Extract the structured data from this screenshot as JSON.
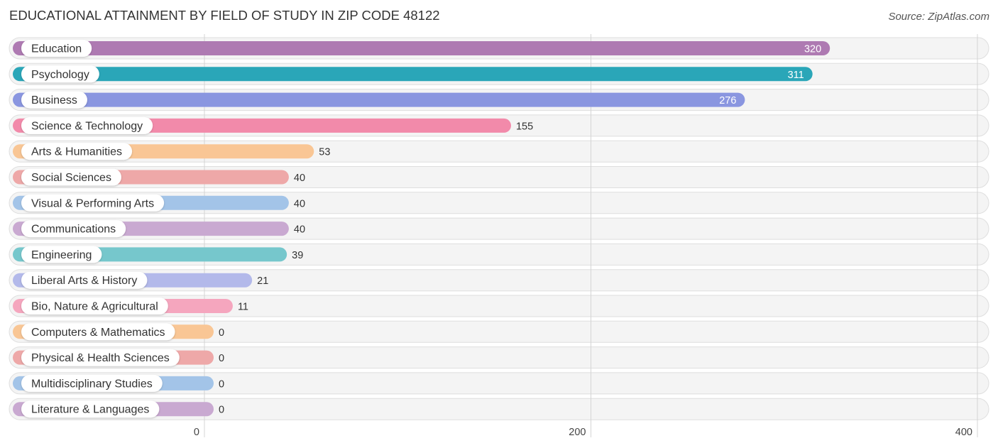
{
  "chart_data": {
    "type": "bar",
    "orientation": "horizontal",
    "title": "EDUCATIONAL ATTAINMENT BY FIELD OF STUDY IN ZIP CODE 48122",
    "source": "Source: ZipAtlas.com",
    "xlabel": "",
    "ylabel": "",
    "xlim": [
      0,
      400
    ],
    "ticks": [
      0,
      200,
      400
    ],
    "tick_labels": [
      "0",
      "200",
      "400"
    ],
    "grid": true,
    "categories": [
      "Education",
      "Psychology",
      "Business",
      "Science & Technology",
      "Arts & Humanities",
      "Social Sciences",
      "Visual & Performing Arts",
      "Communications",
      "Engineering",
      "Liberal Arts & History",
      "Bio, Nature & Agricultural",
      "Computers & Mathematics",
      "Physical & Health Sciences",
      "Multidisciplinary Studies",
      "Literature & Languages"
    ],
    "values": [
      320,
      311,
      276,
      155,
      53,
      40,
      40,
      40,
      39,
      21,
      11,
      0,
      0,
      0,
      0
    ],
    "colors": [
      "#ae7ab2",
      "#2aa6b8",
      "#8a96e0",
      "#f28aaa",
      "#f9c695",
      "#eea8a8",
      "#a3c4e8",
      "#c9a9d1",
      "#76c7cc",
      "#b3b9ea",
      "#f5a6be",
      "#f9c695",
      "#eea8a8",
      "#a3c4e8",
      "#c9a9d1"
    ],
    "value_label_inside_color": "#ffffff",
    "value_label_outside_color": "#333333"
  }
}
